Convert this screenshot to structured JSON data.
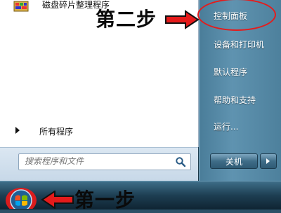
{
  "left_pane": {
    "app_item": {
      "label": "磁盘碎片整理程序",
      "icon": "disk-defrag-icon"
    },
    "all_programs": "所有程序",
    "search_placeholder": "搜索程序和文件"
  },
  "right_pane": {
    "items": [
      {
        "label": "控制面板"
      },
      {
        "label": "设备和打印机"
      },
      {
        "label": "默认程序"
      },
      {
        "label": "帮助和支持"
      },
      {
        "label": "运行..."
      }
    ],
    "shutdown_label": "关机"
  },
  "annotations": {
    "step_two": "第二步",
    "step_one": "第一步",
    "accent": "#e51b1b"
  }
}
